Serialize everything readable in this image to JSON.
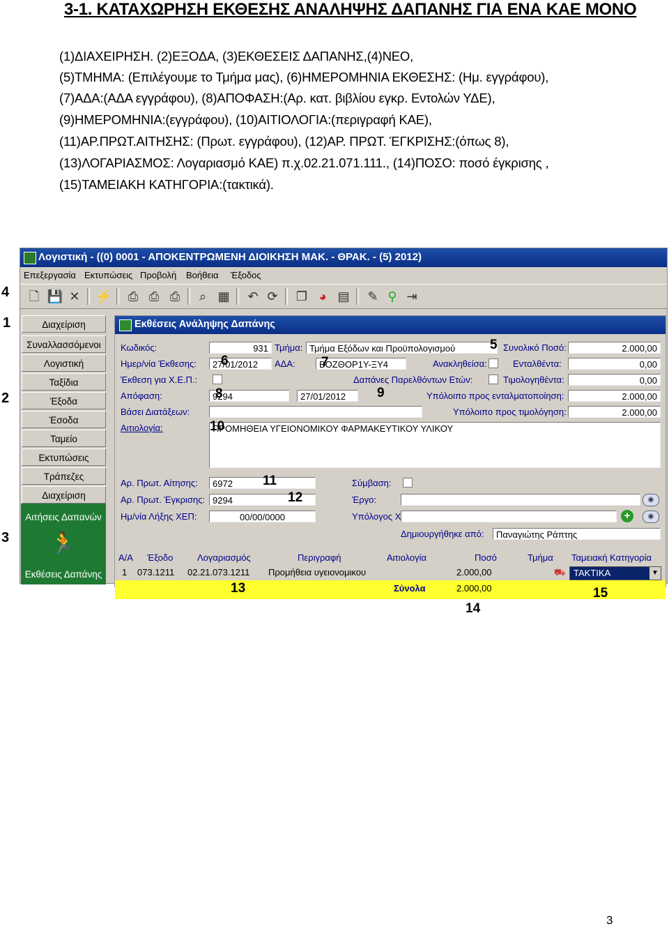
{
  "doc": {
    "title": "3-1. ΚΑΤΑΧΩΡΗΣΗ ΕΚΘΕΣΗΣ ΑΝΑΛΗΨΗΣ ΔΑΠΑΝΗΣ ΓΙΑ ΕΝΑ ΚΑΕ ΜΟΝΟ",
    "lines": [
      "(1)ΔΙΑΧΕΙΡΗΣΗ. (2)ΕΞΟΔΑ, (3)ΕΚΘΕΣΕΙΣ ΔΑΠΑΝΗΣ,(4)ΝΕΟ,",
      "(5)ΤΜΗΜΑ: (Επιλέγουμε το Τμήμα μας), (6)ΗΜΕΡΟΜΗΝΙΑ ΕΚΘΕΣΗΣ: (Ημ. εγγράφου),",
      "(7)ΑΔΑ:(ΑΔΑ εγγράφου), (8)ΑΠΟΦΑΣΗ:(Αρ. κατ. βιβλίου εγκρ. Εντολών ΥΔΕ),",
      "(9)ΗΜΕΡΟΜΗΝΙΑ:(εγγράφου), (10)ΑΙΤΙΟΛΟΓΙΑ:(περιγραφή ΚΑΕ),",
      "(11)ΑΡ.ΠΡΩΤ.ΑΙΤΗΣΗΣ: (Πρωτ. εγγράφου), (12)ΑΡ. ΠΡΩΤ. ΈΓΚΡΙΣΗΣ:(όπως 8),",
      "(13)ΛΟΓΑΡΙΑΣΜΟΣ: Λογαριασμό ΚΑΕ) π.χ.02.21.071.111., (14)ΠΟΣΟ: ποσό έγκρισης ,",
      "(15)ΤΑΜΕΙΑΚΗ ΚΑΤΗΓΟΡΙΑ:(τακτικά)."
    ],
    "page_number": "3"
  },
  "app": {
    "title": "Λογιστική - ((0) 0001 - ΑΠΟΚΕΝΤΡΩΜΕΝΗ ΔΙΟΙΚΗΣΗ ΜΑΚ. - ΘΡΑΚ. - (5) 2012)",
    "menu": [
      "Επεξεργασία",
      "Εκτυπώσεις",
      "Προβολή",
      "Βοήθεια",
      "Έξοδος"
    ],
    "nav": [
      "Διαχείριση",
      "Συναλλασσόμενοι",
      "Λογιστική",
      "Ταξίδια",
      "Έξοδα",
      "Έσοδα",
      "Ταμείο",
      "Εκτυπώσεις",
      "Τράπεζες",
      "Διαχείριση"
    ],
    "nav_green": {
      "top": "Αιτήσεις Δαπανών",
      "bottom": "Εκθέσεις Δαπάνης"
    }
  },
  "form": {
    "title": "Εκθέσεις Ανάληψης Δαπάνης",
    "labels": {
      "kodikos": "Κωδικός:",
      "tmima": "Τμήμα:",
      "synoliko": "Συνολικό Ποσό:",
      "imerominia": "Ημερ/νία Έκθεσης:",
      "ada": "ΑΔΑ:",
      "anaklithesa": "Ανακληθείσα:",
      "entalthenta": "Ενταλθέντα:",
      "xep": "Έκθεση για Χ.Ε.Π.:",
      "dapanes": "Δαπάνες Παρελθόντων Ετών:",
      "timologithenta": "Τιμολογηθέντα:",
      "apofasi": "Απόφαση:",
      "ypoloipo_ental": "Υπόλοιπο προς ενταλματοποίηση:",
      "vasei": "Βάσει Διατάξεων:",
      "ypoloipo_tim": "Υπόλοιπο προς τιμολόγηση:",
      "aitiologia": "Αιτιολογία:",
      "ar_aitisis": "Αρ. Πρωτ. Αίτησης:",
      "symvasi": "Σύμβαση:",
      "ar_egkrisis": "Αρ. Πρωτ. Έγκρισης:",
      "ergo": "Έργο:",
      "lixi": "Ημ/νία Λήξης ΧΕΠ:",
      "ypologos": "Υπόλογος ΧΕΠ:",
      "dimiourgithike": "Δημιουργήθηκε από:"
    },
    "values": {
      "kodikos": "931",
      "tmima": "Τμήμα Εξόδων και Προϋπολογισμού",
      "synoliko": "2.000,00",
      "imerominia": "27/01/2012",
      "ada": "ΒΟΖΘΟΡ1Υ-ΞΥ4",
      "entalthenta": "0,00",
      "timologithenta": "0,00",
      "apofasi": "9294",
      "apofasi_date": "27/01/2012",
      "ypoloipo_ental": "2.000,00",
      "ypoloipo_tim": "2.000,00",
      "aitiologia": "ΠΡΟΜΗΘΕΙΑ ΥΓΕΙΟΝΟΜΙΚΟΥ ΦΑΡΜΑΚΕΥΤΙΚΟΥ ΥΛΙΚΟΥ",
      "ar_aitisis": "6972",
      "ar_egkrisis": "9294",
      "lixi": "00/00/0000",
      "dimiourgithike": "Παναγιώτης Ράπτης"
    },
    "grid": {
      "headers": [
        "Α/Α",
        "Έξοδο",
        "Λογαριασμός",
        "Περιγραφή",
        "Αιτιολογία",
        "Ποσό",
        "Τμήμα",
        "Ταμειακή Κατηγορία"
      ],
      "row": {
        "aa": "1",
        "exodo": "073.1211",
        "logariasmos": "02.21.073.1211",
        "perigrafi": "Προμήθεια υγειονομικου",
        "poso": "2.000,00",
        "kategoria": "ΤΑΚΤΙΚΑ"
      },
      "totals_label": "Σύνολα",
      "totals_value": "2.000,00"
    }
  },
  "callouts": [
    "1",
    "2",
    "3",
    "4",
    "5",
    "6",
    "7",
    "8",
    "9",
    "10",
    "11",
    "12",
    "13",
    "14",
    "15"
  ]
}
